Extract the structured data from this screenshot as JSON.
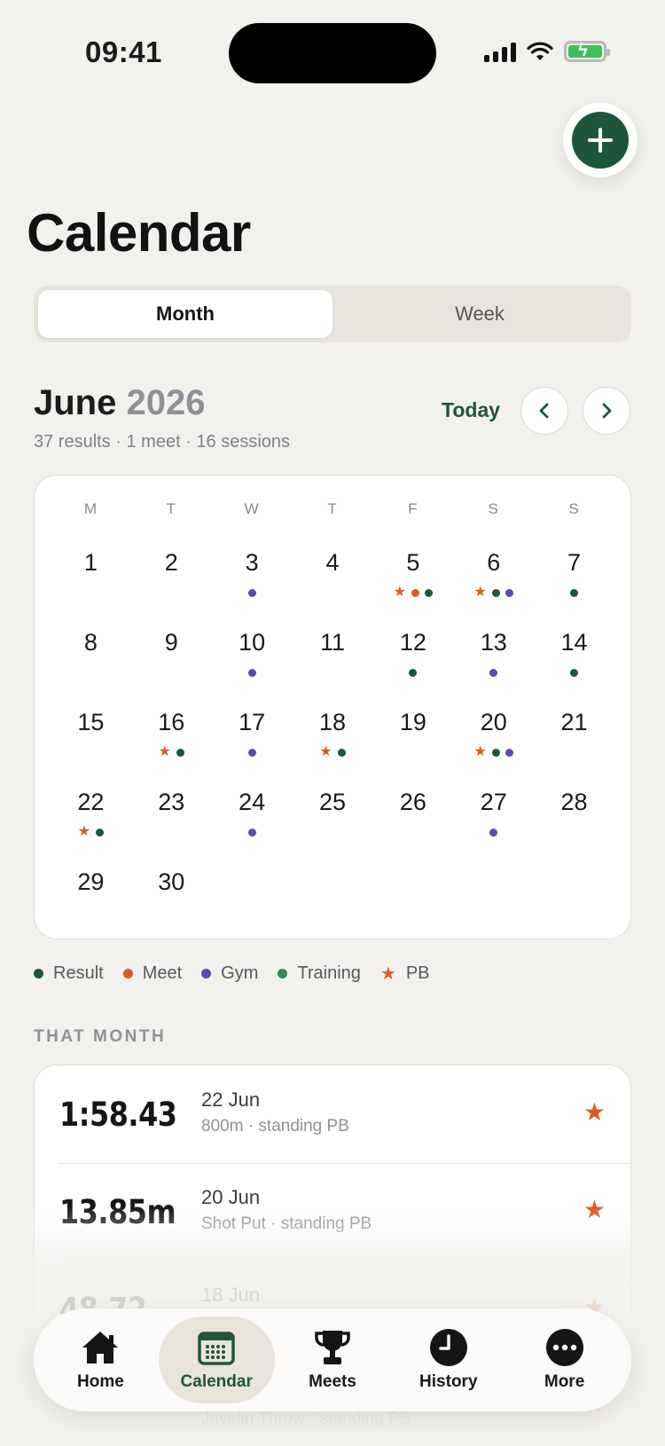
{
  "status_bar": {
    "time": "09:41"
  },
  "header": {
    "title": "Calendar",
    "add_icon": "plus-icon"
  },
  "segment": {
    "month": "Month",
    "week": "Week",
    "selected": "Month"
  },
  "month_header": {
    "month": "June",
    "year": "2026",
    "summary": "37 results · 1 meet · 16 sessions",
    "today": "Today"
  },
  "calendar": {
    "weekdays": [
      "M",
      "T",
      "W",
      "T",
      "F",
      "S",
      "S"
    ],
    "leading_blank_days": 0,
    "days": [
      {
        "n": "1",
        "marks": []
      },
      {
        "n": "2",
        "marks": []
      },
      {
        "n": "3",
        "marks": [
          "gym"
        ]
      },
      {
        "n": "4",
        "marks": []
      },
      {
        "n": "5",
        "marks": [
          "pb",
          "meet",
          "result"
        ]
      },
      {
        "n": "6",
        "marks": [
          "pb",
          "result",
          "gym"
        ]
      },
      {
        "n": "7",
        "marks": [
          "result"
        ]
      },
      {
        "n": "8",
        "marks": []
      },
      {
        "n": "9",
        "marks": []
      },
      {
        "n": "10",
        "marks": [
          "gym"
        ]
      },
      {
        "n": "11",
        "marks": []
      },
      {
        "n": "12",
        "marks": [
          "result"
        ]
      },
      {
        "n": "13",
        "marks": [
          "gym"
        ]
      },
      {
        "n": "14",
        "marks": [
          "result"
        ]
      },
      {
        "n": "15",
        "marks": []
      },
      {
        "n": "16",
        "marks": [
          "pb",
          "result"
        ]
      },
      {
        "n": "17",
        "marks": [
          "gym"
        ]
      },
      {
        "n": "18",
        "marks": [
          "pb",
          "result"
        ]
      },
      {
        "n": "19",
        "marks": []
      },
      {
        "n": "20",
        "marks": [
          "pb",
          "result",
          "gym"
        ]
      },
      {
        "n": "21",
        "marks": []
      },
      {
        "n": "22",
        "marks": [
          "pb",
          "result"
        ]
      },
      {
        "n": "23",
        "marks": []
      },
      {
        "n": "24",
        "marks": [
          "gym"
        ]
      },
      {
        "n": "25",
        "marks": []
      },
      {
        "n": "26",
        "marks": []
      },
      {
        "n": "27",
        "marks": [
          "gym"
        ]
      },
      {
        "n": "28",
        "marks": []
      },
      {
        "n": "29",
        "marks": []
      },
      {
        "n": "30",
        "marks": []
      }
    ]
  },
  "legend": [
    {
      "key": "result",
      "label": "Result",
      "color": "#1d5638",
      "shape": "dot"
    },
    {
      "key": "meet",
      "label": "Meet",
      "color": "#df5a22",
      "shape": "dot"
    },
    {
      "key": "gym",
      "label": "Gym",
      "color": "#5b48b8",
      "shape": "dot"
    },
    {
      "key": "training",
      "label": "Training",
      "color": "#2f8a55",
      "shape": "dot"
    },
    {
      "key": "pb",
      "label": "PB",
      "color": "#df5a22",
      "shape": "star"
    }
  ],
  "section": {
    "title": "THAT MONTH"
  },
  "results": [
    {
      "value": "1:58.43",
      "date": "22 Jun",
      "desc": "800m · standing PB",
      "pb": true
    },
    {
      "value": "13.85m",
      "date": "20 Jun",
      "desc": "Shot Put · standing PB",
      "pb": true
    },
    {
      "value": "48.72",
      "date": "18 Jun",
      "desc": "",
      "pb": true
    },
    {
      "value": "",
      "date": "",
      "desc": "Javelin Throw · standing PB",
      "pb": true
    }
  ],
  "tabbar": {
    "active": "Calendar",
    "items": [
      {
        "label": "Home",
        "icon": "home-icon"
      },
      {
        "label": "Calendar",
        "icon": "calendar-icon"
      },
      {
        "label": "Meets",
        "icon": "trophy-icon"
      },
      {
        "label": "History",
        "icon": "clock-icon"
      },
      {
        "label": "More",
        "icon": "more-icon"
      }
    ]
  },
  "colors": {
    "accent": "#1d5638",
    "pb": "#df5a22",
    "gym": "#5b48b8",
    "background": "#f3f1ee"
  }
}
